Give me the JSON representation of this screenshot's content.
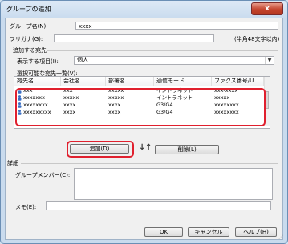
{
  "window": {
    "title": "グループの追加",
    "close_glyph": "x"
  },
  "form": {
    "group_name_label": "グループ名(N):",
    "group_name_value": "xxxx",
    "furigana_label": "フリガナ(G):",
    "furigana_value": "",
    "furigana_hint": "(半角48文字以内)"
  },
  "add_section": {
    "title": "追加する宛先",
    "display_label": "表示する項目(I):",
    "display_value": "個人",
    "list_label": "選択可能な宛先一覧(V):"
  },
  "list": {
    "columns": [
      "宛先名",
      "会社名",
      "部署名",
      "通信モード",
      "ファクス番号/U..."
    ],
    "rows": [
      [
        "xxx",
        "xxx",
        "xxxxx",
        "イントラネット",
        "xxx-xxxx"
      ],
      [
        "xxxxxxx",
        "xxxxx",
        "xxxxx",
        "イントラネット",
        "xxxxx"
      ],
      [
        "xxxxxxxx",
        "xxxx",
        "xxxx",
        "G3/G4",
        "xxxxxxxx"
      ],
      [
        "xxxxxxxxx",
        "xxxx",
        "xxxx",
        "G3/G4",
        "xxxxxxxx"
      ]
    ]
  },
  "buttons": {
    "add": "追加(D)",
    "remove": "削除(L)",
    "ok": "OK",
    "cancel": "キャンセル",
    "help": "ヘルプ(H)"
  },
  "details": {
    "title": "詳細",
    "members_label": "グループメンバー(C):",
    "memo_label": "メモ(E):",
    "memo_value": ""
  },
  "colors": {
    "highlight": "#e0202e",
    "user_icon": "#3a6fc4"
  }
}
